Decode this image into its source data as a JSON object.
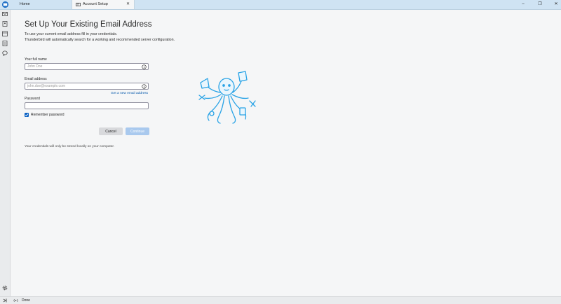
{
  "tabs": [
    {
      "label": "Home",
      "active": false
    },
    {
      "label": "Account Setup",
      "active": true
    }
  ],
  "window_controls": {
    "minimize": "–",
    "maximize": "❐",
    "close": "✕"
  },
  "tab_close_symbol": "✕",
  "page": {
    "title": "Set Up Your Existing Email Address",
    "intro_line1": "To use your current email address fill in your credentials.",
    "intro_line2": "Thunderbird will automatically search for a working and recommended server configuration."
  },
  "form": {
    "name_label": "Your full name",
    "name_placeholder": "John Doe",
    "email_label": "Email address",
    "email_placeholder": "john.doe@example.com",
    "new_email_link": "Get a new email address",
    "password_label": "Password",
    "password_value": "",
    "remember_label": "Remember password",
    "remember_checked": true,
    "cancel_label": "Cancel",
    "continue_label": "Continue",
    "continue_enabled": false,
    "footnote": "Your credentials will only be stored locally on your computer."
  },
  "status": {
    "text": "Done"
  },
  "icons": {
    "app": "thunderbird-icon",
    "spaces": [
      "mail-icon",
      "address-book-icon",
      "calendar-icon",
      "tasks-icon",
      "chat-icon"
    ],
    "settings": "gear-icon",
    "collapse": "collapse-sidebar-icon",
    "status": "radio-waves-icon"
  },
  "colors": {
    "accent": "#0b62c4",
    "link": "#0b5cad",
    "tabbar": "#cfe3f3",
    "mascot": "#29a3e6"
  }
}
